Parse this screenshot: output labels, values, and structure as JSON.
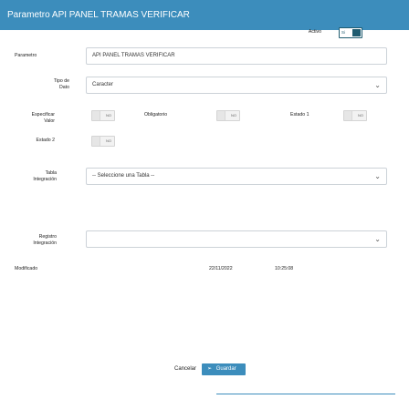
{
  "window": {
    "title": "Parametro API PANEL TRAMAS VERIFICAR"
  },
  "activo": {
    "label": "Activo",
    "toggle_text": "Si",
    "state": true
  },
  "form": {
    "parametro": {
      "label": "Parametro",
      "value": "API PANEL TRAMAS VERIFICAR"
    },
    "tipo_dato": {
      "label_line1": "Tipo de",
      "label_line2": "Dato",
      "value": "Caracter"
    },
    "especificar_valor": {
      "label_line1": "Especificar",
      "label_line2": "Valor",
      "toggle_text": "NO",
      "state": false
    },
    "obligatorio": {
      "label": "Obligatorio",
      "toggle_text": "NO",
      "state": false
    },
    "estado1": {
      "label": "Estado 1",
      "toggle_text": "NO",
      "state": false
    },
    "estado2": {
      "label": "Estado 2",
      "toggle_text": "NO",
      "state": false
    },
    "tabla_integracion": {
      "label_line1": "Tabla",
      "label_line2": "Integración",
      "value": "-- Seleccione una Tabla --"
    },
    "registro_integracion": {
      "label_line1": "Registro",
      "label_line2": "Integración",
      "value": ""
    },
    "modificado": {
      "label": "Modificado",
      "date": "22/11/2022",
      "time": "10:25:08"
    }
  },
  "actions": {
    "cancel_label": "Cancelar",
    "save_label": "Guardar"
  },
  "colors": {
    "header": "#3c8dbc",
    "toggle_on": "#1f5c70",
    "border": "#ccd2d8"
  },
  "icons": {
    "select_chevron": "chevron-down-icon",
    "save": "save-icon"
  }
}
